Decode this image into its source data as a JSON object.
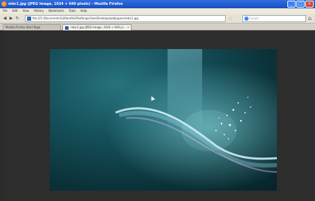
{
  "window": {
    "title": "mbc1.jpg (JPEG Image, 1024 × 640 pixels) - Mozilla Firefox",
    "buttons": {
      "minimize": "_",
      "maximize": "□",
      "close": "×"
    }
  },
  "menu": [
    "File",
    "Edit",
    "View",
    "History",
    "Bookmarks",
    "Tools",
    "Help"
  ],
  "nav": {
    "back": "◀",
    "forward": "▶",
    "reload": "↻",
    "stop": "✕",
    "url": "file:///C:/Documents%20and%20Settings/User/Desktop/wallpapers/mbc1.jpg",
    "star": "☆",
    "search_placeholder": "Google",
    "home": "⌂"
  },
  "tabs": [
    {
      "label": "Mozilla Firefox Start Page"
    },
    {
      "label": "mbc1.jpg (JPEG Image, 1024 × 640 pi...",
      "close": "×"
    }
  ]
}
